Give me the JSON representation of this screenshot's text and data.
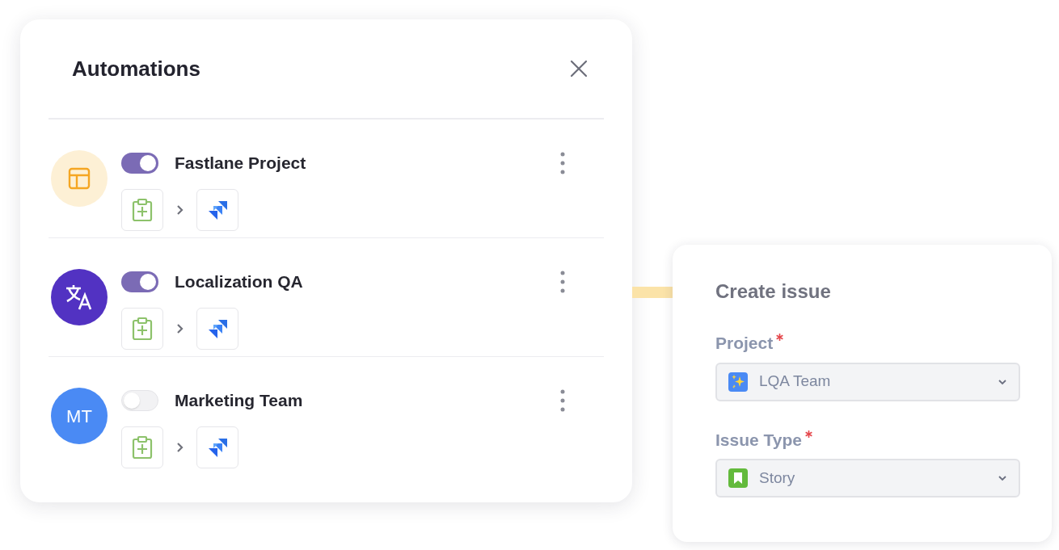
{
  "automations_panel": {
    "title": "Automations",
    "automations": [
      {
        "name": "Fastlane Project",
        "on": true,
        "avatar": {
          "kind": "layout",
          "color": "#fdf0d5"
        }
      },
      {
        "name": "Localization QA",
        "on": true,
        "avatar": {
          "kind": "translate",
          "color": "#5232c2"
        }
      },
      {
        "name": "Marketing Team",
        "on": false,
        "avatar": {
          "kind": "initials",
          "text": "MT",
          "color": "#4a8af4"
        }
      }
    ]
  },
  "create_issue": {
    "title": "Create issue",
    "fields": [
      {
        "label": "Project",
        "required": true,
        "value": "LQA Team",
        "kind": "project"
      },
      {
        "label": "Issue Type",
        "required": true,
        "value": "Story",
        "kind": "story"
      }
    ]
  }
}
